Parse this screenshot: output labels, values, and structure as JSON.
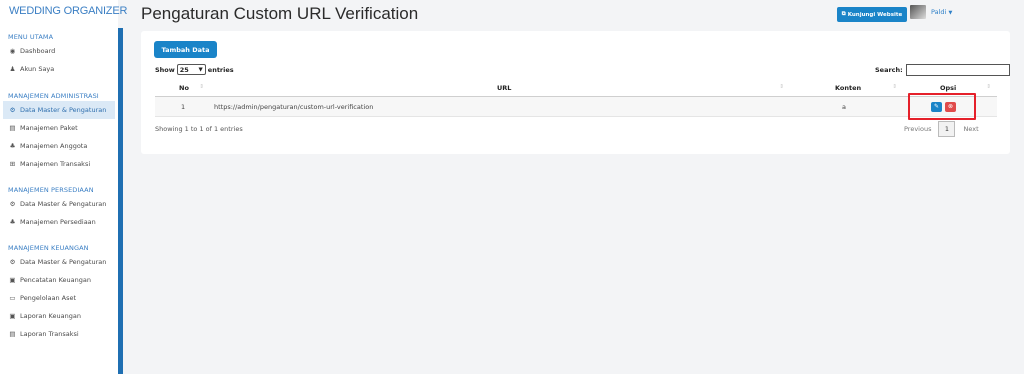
{
  "brand": {
    "name": "WEDDING ORGANIZER"
  },
  "sidebar": {
    "sections": [
      {
        "title": "MENU UTAMA",
        "items": [
          {
            "label": "Dashboard",
            "icon": "dashboard-icon"
          },
          {
            "label": "Akun Saya",
            "icon": "user-icon"
          }
        ]
      },
      {
        "title": "MANAJEMEN ADMINISTRASI",
        "items": [
          {
            "label": "Data Master & Pengaturan",
            "icon": "cogs-icon",
            "active": true
          },
          {
            "label": "Manajemen Paket",
            "icon": "book-icon"
          },
          {
            "label": "Manajemen Anggota",
            "icon": "users-icon"
          },
          {
            "label": "Manajemen Transaksi",
            "icon": "cart-icon"
          }
        ]
      },
      {
        "title": "MANAJEMEN PERSEDIAAN",
        "items": [
          {
            "label": "Data Master & Pengaturan",
            "icon": "cogs-icon"
          },
          {
            "label": "Manajemen Persediaan",
            "icon": "boxes-icon"
          }
        ]
      },
      {
        "title": "MANAJEMEN KEUANGAN",
        "items": [
          {
            "label": "Data Master & Pengaturan",
            "icon": "cogs-icon"
          },
          {
            "label": "Pencatatan Keuangan",
            "icon": "money-icon"
          },
          {
            "label": "Pengelolaan Aset",
            "icon": "laptop-icon"
          },
          {
            "label": "Laporan Keuangan",
            "icon": "money-icon"
          },
          {
            "label": "Laporan Transaksi",
            "icon": "book-icon"
          }
        ]
      }
    ]
  },
  "header": {
    "title": "Pengaturan Custom URL Verification",
    "visit_label": "Kunjungi Website",
    "user_name": "Paldi"
  },
  "card": {
    "add_label": "Tambah Data",
    "show_label": "Show",
    "entries_value": "25",
    "entries_label": "entries",
    "search_label": "Search:",
    "search_value": "",
    "columns": {
      "no": "No",
      "url": "URL",
      "konten": "Konten",
      "opsi": "Opsi"
    },
    "rows": [
      {
        "no": "1",
        "url": "https://admin/pengaturan/custom-url-verification",
        "konten": "a"
      }
    ],
    "info": "Showing 1 to 1 of 1 entries",
    "pager": {
      "previous": "Previous",
      "page": "1",
      "next": "Next"
    }
  },
  "colors": {
    "primary": "#1a84c8",
    "danger": "#e04b4b",
    "highlight": "#e5202a",
    "sidebar_edge": "#1f6fb2"
  }
}
